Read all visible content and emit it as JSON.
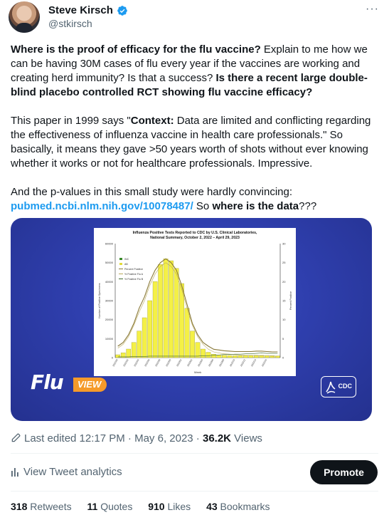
{
  "author": {
    "name": "Steve Kirsch",
    "handle": "@stkirsch"
  },
  "more_label": "···",
  "tweet": {
    "p1_bold": "Where is the proof of efficacy for the flu vaccine?",
    "p1_text": " Explain to me how we can be having 30M cases of flu every year if the vaccines are working and creating herd immunity? Is that a success?  ",
    "p1_bold2": "Is there a recent large double-blind placebo controlled RCT showing flu vaccine efficacy?",
    "p2_text1": "This paper in 1999 says \"",
    "p2_bold": "Context:",
    "p2_text2": " Data are limited and conflicting regarding the effectiveness of influenza vaccine in health care professionals.\" So basically, it means they gave >50 years worth of shots without ever knowing whether it works or not for healthcare professionals. Impressive.",
    "p3_text1": "And the p-values in this small study were hardly convincing: ",
    "p3_link": "pubmed.ncbi.nlm.nih.gov/10078487/",
    "p3_text2": " So ",
    "p3_bold": "where is the data",
    "p3_text3": "???"
  },
  "media": {
    "chart_title_line1": "Influenza Positive Tests Reported to CDC by U.S. Clinical Laboratories,",
    "chart_title_line2": "National Summary, October 2, 2022 – April 29, 2023",
    "logo_flu": "Flu",
    "logo_view": "VIEW",
    "cdc_label": "CDC"
  },
  "chart_data": {
    "type": "bar",
    "title": "Influenza Positive Tests Reported to CDC by U.S. Clinical Laboratories, National Summary, October 2, 2022 – April 29, 2023",
    "xlabel": "Week",
    "ylabel": "Number of Positive Specimens",
    "ylabel_right": "Percent Positive",
    "ylim": [
      0,
      60000
    ],
    "ylim_right": [
      0,
      30
    ],
    "y_ticks": [
      "0",
      "10000",
      "20000",
      "30000",
      "40000",
      "50000",
      "60000"
    ],
    "y_ticks_right": [
      "0",
      "5",
      "10",
      "15",
      "20",
      "25",
      "30"
    ],
    "legend": [
      "INC",
      "AB",
      "Percent Positive",
      "% Positive Flu A",
      "% Positive Flu B"
    ],
    "x_tick_labels": [
      "202240",
      "202242",
      "202244",
      "202246",
      "202248",
      "202250",
      "202252",
      "202302",
      "202304",
      "202306",
      "202308",
      "202310",
      "202312",
      "202314",
      "202316"
    ],
    "values": [
      1500,
      2500,
      4500,
      8000,
      14000,
      21000,
      30000,
      40000,
      49000,
      52000,
      51000,
      47000,
      39000,
      26000,
      14000,
      8000,
      4500,
      2800,
      1800,
      1400,
      1200,
      1100,
      1000,
      1000,
      1100,
      1100,
      1200,
      1200,
      1100,
      1000,
      900
    ],
    "series_percent_positive": [
      3,
      4,
      6,
      9,
      13,
      16,
      20,
      23,
      25,
      26,
      25,
      23,
      19,
      14,
      9,
      6,
      4,
      3,
      2.2,
      2,
      1.8,
      1.7,
      1.6,
      1.6,
      1.6,
      1.6,
      1.7,
      1.7,
      1.6,
      1.5,
      1.5
    ],
    "series_flu_a": [
      2.5,
      3.5,
      5.5,
      8.5,
      12,
      15,
      19,
      22,
      24,
      25,
      24,
      22,
      18,
      13,
      8.5,
      5.5,
      3.5,
      2.2,
      1.5,
      1.2,
      1,
      0.9,
      0.8,
      0.7,
      0.6,
      0.6,
      0.5,
      0.5,
      0.5,
      0.4,
      0.4
    ],
    "series_flu_b": [
      0.2,
      0.2,
      0.2,
      0.3,
      0.3,
      0.3,
      0.4,
      0.4,
      0.4,
      0.4,
      0.4,
      0.4,
      0.4,
      0.4,
      0.4,
      0.4,
      0.5,
      0.5,
      0.6,
      0.7,
      0.8,
      0.8,
      0.9,
      0.9,
      1,
      1,
      1.1,
      1.2,
      1.1,
      1.1,
      1.1
    ]
  },
  "meta": {
    "edited_label": "Last edited 12:17 PM · May 6, 2023 · ",
    "views_count": "36.2K",
    "views_label": " Views"
  },
  "actions": {
    "analytics_label": "View Tweet analytics",
    "promote_label": "Promote"
  },
  "stats": {
    "retweets_count": "318",
    "retweets_label": "Retweets",
    "quotes_count": "11",
    "quotes_label": "Quotes",
    "likes_count": "910",
    "likes_label": "Likes",
    "bookmarks_count": "43",
    "bookmarks_label": "Bookmarks"
  },
  "colors": {
    "link": "#1d9bf0",
    "verified": "#1d9bf0",
    "bar_fill": "#f4f046",
    "percent_line": "#8a7a3a"
  }
}
